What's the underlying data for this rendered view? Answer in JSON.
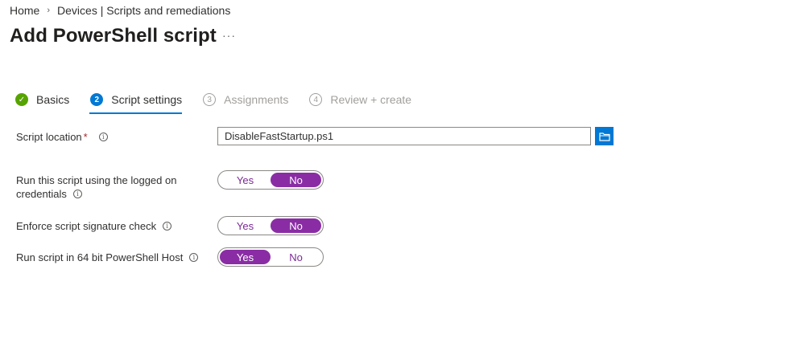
{
  "breadcrumb": {
    "home": "Home",
    "separator": "›",
    "devices": "Devices | Scripts and remediations"
  },
  "page": {
    "title": "Add PowerShell script",
    "more": "···"
  },
  "steps": [
    {
      "number": "✓",
      "label": "Basics",
      "state": "done"
    },
    {
      "number": "2",
      "label": "Script settings",
      "state": "current"
    },
    {
      "number": "3",
      "label": "Assignments",
      "state": "pending"
    },
    {
      "number": "4",
      "label": "Review + create",
      "state": "pending"
    }
  ],
  "form": {
    "script_location": {
      "label": "Script location",
      "required": "*",
      "value": "DisableFastStartup.ps1",
      "browse_icon": "folder-icon"
    },
    "logged_on": {
      "label_line1": "Run this script using the logged on",
      "label_line2": "credentials",
      "yes": "Yes",
      "no": "No",
      "selected": "No"
    },
    "signature": {
      "label": "Enforce script signature check",
      "yes": "Yes",
      "no": "No",
      "selected": "No"
    },
    "host64": {
      "label": "Run script in 64 bit PowerShell Host",
      "yes": "Yes",
      "no": "No",
      "selected": "Yes"
    },
    "info_icon": "i"
  },
  "colors": {
    "accent": "#0078d4",
    "toggle_selected": "#8a2da5",
    "done": "#57a300",
    "required": "#a4262c"
  }
}
